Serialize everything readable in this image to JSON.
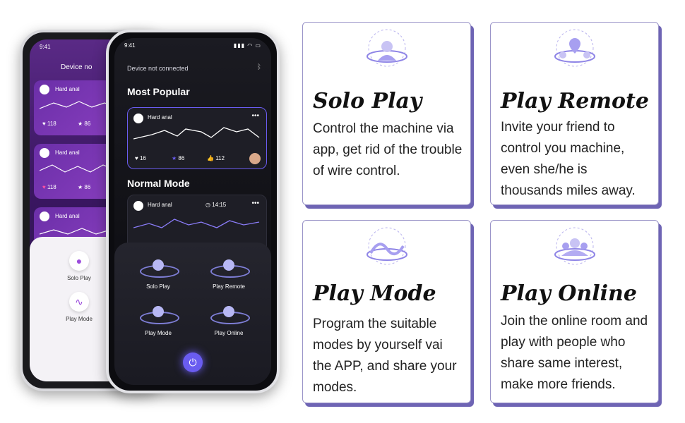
{
  "back_phone": {
    "time": "9:41",
    "header": "Device no",
    "cards": [
      {
        "name": "Hard anal",
        "likes": "118",
        "stars": "86"
      },
      {
        "name": "Hard anal",
        "likes": "118",
        "stars": "86"
      },
      {
        "name": "Hard anal"
      }
    ],
    "buttons": [
      {
        "label": "Solo Play",
        "icon": "person-icon"
      },
      {
        "label": "Play Mode",
        "icon": "wave-icon"
      }
    ]
  },
  "front_phone": {
    "time": "9:41",
    "device_status": "Device not connected",
    "most_popular_title": "Most Popular",
    "popular_card": {
      "name": "Hard anal",
      "likes": "16",
      "stars": "86",
      "thumbs": "112"
    },
    "normal_mode_title": "Normal Mode",
    "normal_card": {
      "name": "Hard anal",
      "time": "14:15"
    },
    "modes": [
      {
        "label": "Solo Play"
      },
      {
        "label": "Play Remote"
      },
      {
        "label": "Play Mode"
      },
      {
        "label": "Play Online"
      }
    ]
  },
  "features": [
    {
      "title": "Solo Play",
      "description": "Control the machine via app, get rid of the trouble of wire control."
    },
    {
      "title": "Play Remote",
      "description": "Invite your friend to control you machine, even she/he is thousands miles away."
    },
    {
      "title": "Play Mode",
      "description": "Program the suitable modes by yourself vai the APP, and share your modes."
    },
    {
      "title": "Play Online",
      "description": "Join the online room and play with people who share same interest, make more friends."
    }
  ],
  "colors": {
    "accent": "#6a5cf0",
    "purple": "#8a3fc0",
    "card_border": "#6e64b4"
  }
}
